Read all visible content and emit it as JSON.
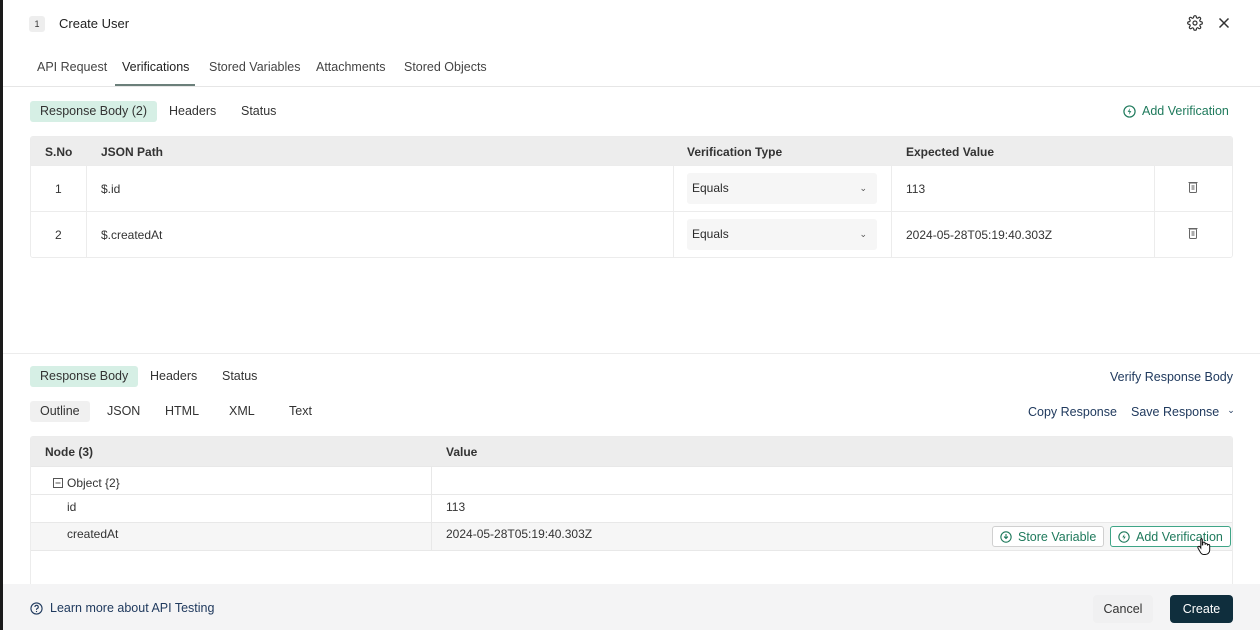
{
  "header": {
    "step_number": "1",
    "title": "Create User"
  },
  "tabs": [
    {
      "label": "API Request",
      "active": false
    },
    {
      "label": "Verifications",
      "active": true
    },
    {
      "label": "Stored Variables",
      "active": false
    },
    {
      "label": "Attachments",
      "active": false
    },
    {
      "label": "Stored Objects",
      "active": false
    }
  ],
  "verifications": {
    "subtabs": [
      {
        "label": "Response Body (2)",
        "active": true
      },
      {
        "label": "Headers",
        "active": false
      },
      {
        "label": "Status",
        "active": false
      }
    ],
    "add_label": "Add Verification",
    "columns": [
      "S.No",
      "JSON Path",
      "Verification Type",
      "Expected Value"
    ],
    "rows": [
      {
        "sno": "1",
        "path": "$.id",
        "type": "Equals",
        "expected": "113"
      },
      {
        "sno": "2",
        "path": "$.createdAt",
        "type": "Equals",
        "expected": "2024-05-28T05:19:40.303Z"
      }
    ]
  },
  "response": {
    "subtabs": [
      {
        "label": "Response Body",
        "active": true
      },
      {
        "label": "Headers",
        "active": false
      },
      {
        "label": "Status",
        "active": false
      }
    ],
    "verify_label": "Verify Response Body",
    "formats": [
      {
        "label": "Outline",
        "active": true
      },
      {
        "label": "JSON",
        "active": false
      },
      {
        "label": "HTML",
        "active": false
      },
      {
        "label": "XML",
        "active": false
      },
      {
        "label": "Text",
        "active": false
      }
    ],
    "copy_label": "Copy Response",
    "save_label": "Save Response",
    "columns": [
      "Node (3)",
      "Value"
    ],
    "nodes": [
      {
        "node": "Object {2}",
        "value": ""
      },
      {
        "node": "id",
        "value": "113"
      },
      {
        "node": "createdAt",
        "value": "2024-05-28T05:19:40.303Z"
      }
    ],
    "store_variable_label": "Store Variable",
    "add_verification_label": "Add Verification"
  },
  "footer": {
    "help_label": "Learn more about API Testing",
    "cancel_label": "Cancel",
    "create_label": "Create"
  },
  "colors": {
    "accent_green": "#1f7a5c",
    "pill_green": "#d6efe5",
    "primary_button": "#0f2e3d",
    "link_blue": "#203a5e"
  }
}
